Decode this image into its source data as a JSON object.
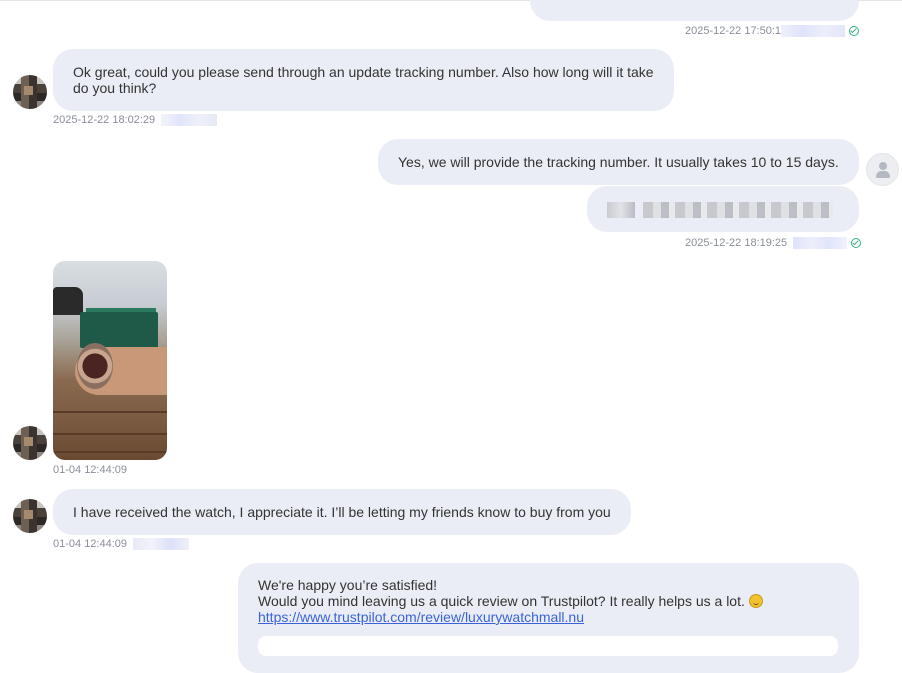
{
  "messages": {
    "m0": {
      "timestamp": "2025-12-22 17:50:1"
    },
    "m1": {
      "text": "Ok great, could you please send through an update tracking number. Also how long will it take do you think?",
      "timestamp": "2025-12-22 18:02:29"
    },
    "m2": {
      "text": "Yes, we will provide the tracking number. It usually takes 10 to 15 days.",
      "timestamp": "2025-12-22 18:19:25"
    },
    "m3": {
      "timestamp": "01-04 12:44:09"
    },
    "m4": {
      "text": "I have received the watch, I appreciate it. I’ll be letting my friends know to buy from you",
      "timestamp": "01-04 12:44:09"
    },
    "m5": {
      "line1": "We're happy you’re satisfied!",
      "line2": "Would you mind leaving us a quick review on Trustpilot? It really helps us a lot.",
      "link": "https://www.trustpilot.com/review/luxurywatchmall.nu"
    }
  },
  "icons": {
    "read_receipt": "check-circle-icon",
    "agent_avatar": "user-icon",
    "emoji": "smiling-face-icon"
  },
  "colors": {
    "bubble": "#eaedf5",
    "link": "#3b63d9",
    "read_check": "#35b37e",
    "meta_text": "#8a8f99"
  }
}
